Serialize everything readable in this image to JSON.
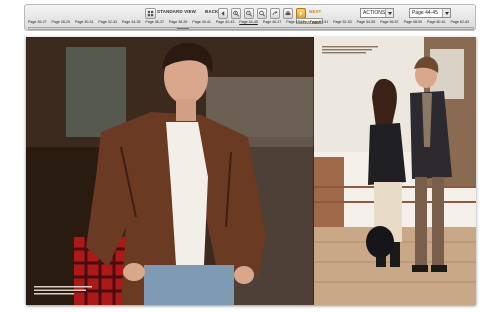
{
  "toolbar": {
    "view_label": "STANDARD VIEW",
    "back_label": "BACK",
    "next_label": "NEXT",
    "tooltip": "To next page",
    "actions_label": "ACTIONS",
    "page_select_value": "Page 44-45"
  },
  "page_ranges": [
    "Page 26-27",
    "Page 28-29",
    "Page 30-31",
    "Page 32-33",
    "Page 34-35",
    "Page 36-37",
    "Page 38-39",
    "Page 40-41",
    "Page 42-43",
    "Page 44-45",
    "Page 46-47",
    "Page 48-49",
    "Page 50-51",
    "Page 52-53",
    "Page 54-55",
    "Page 56-57",
    "Page 58-59",
    "Page 60-61",
    "Page 62-63"
  ],
  "current_page_index": 9,
  "colors": {
    "next_accent": "#e0a020",
    "jacket_brown": "#6a3a22",
    "shirt_white": "#f2efe9",
    "jeans_blue": "#7f9bb4",
    "plaid_red": "#b01818"
  }
}
